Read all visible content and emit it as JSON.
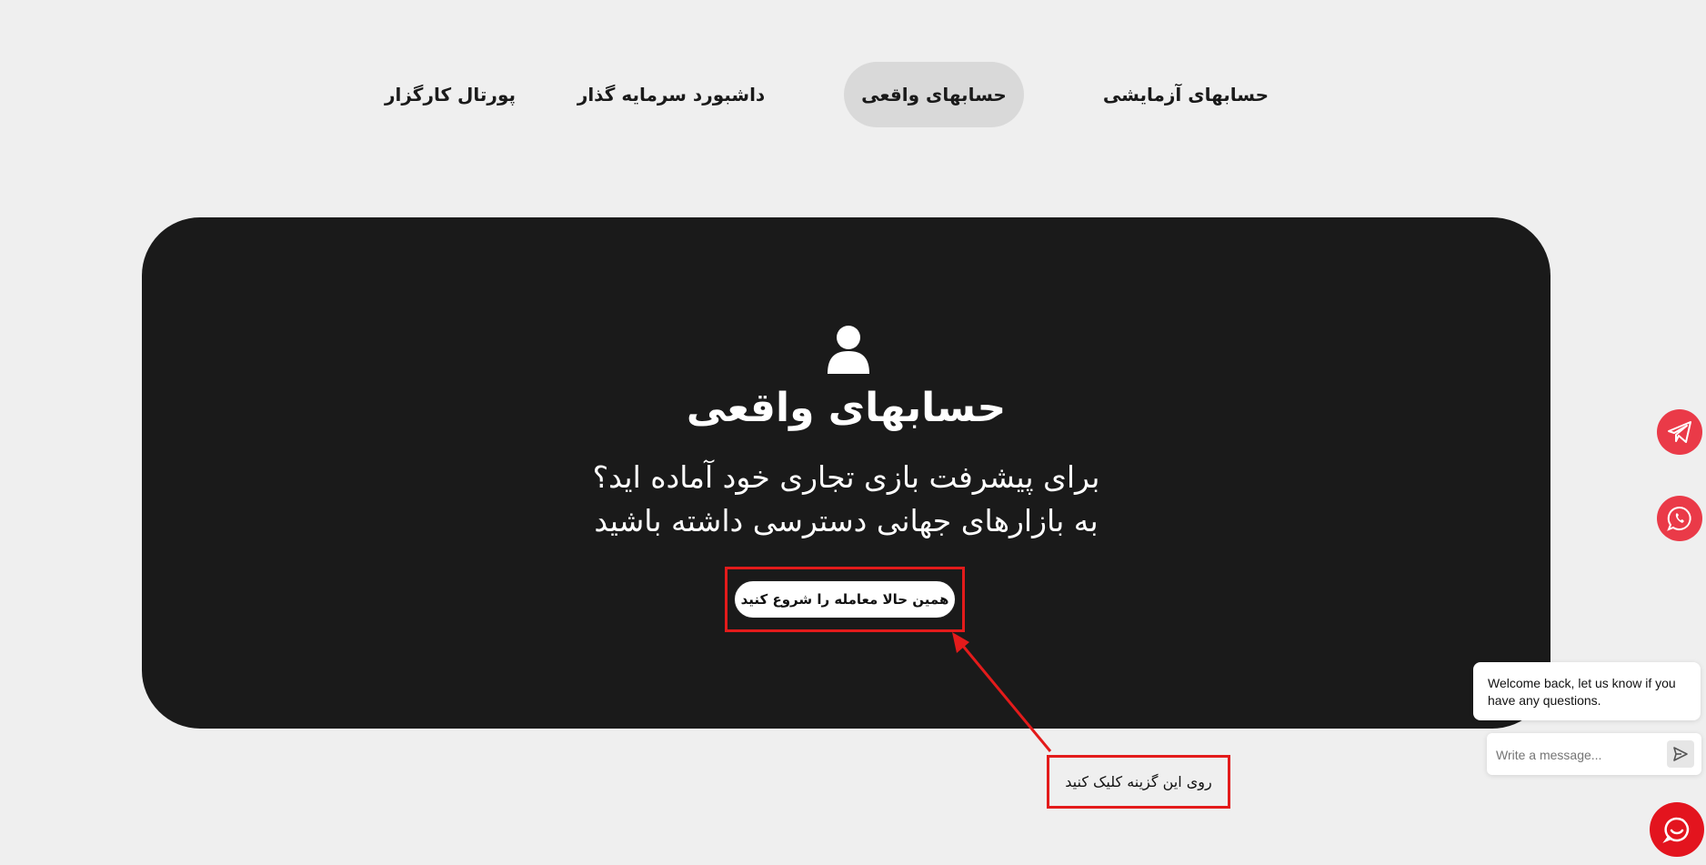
{
  "nav": {
    "tabs": [
      {
        "label": "حسابهای آزمایشی",
        "active": false
      },
      {
        "label": "حسابهای واقعی",
        "active": true
      },
      {
        "label": "داشبورد سرمایه گذار",
        "active": false
      },
      {
        "label": "پورتال کارگزار",
        "active": false
      }
    ]
  },
  "hero": {
    "icon": "user-icon",
    "title": "حسابهای واقعی",
    "subtitle_line1": "برای پیشرفت بازی تجاری خود آماده اید؟",
    "subtitle_line2": "به بازارهای جهانی دسترسی داشته باشید",
    "cta_label": "همین حالا معامله را شروع کنید"
  },
  "annotation": {
    "note": "روی این گزینه کلیک کنید",
    "color": "#e31b1b"
  },
  "floating": {
    "telegram_icon": "telegram-icon",
    "whatsapp_icon": "whatsapp-icon",
    "accent": "#ea3a48"
  },
  "chat": {
    "welcome": "Welcome back, let us know if you have any questions.",
    "placeholder": "Write a message...",
    "send_icon": "send-icon",
    "launcher_icon": "chat-icon",
    "launcher_color": "#e3141e"
  }
}
